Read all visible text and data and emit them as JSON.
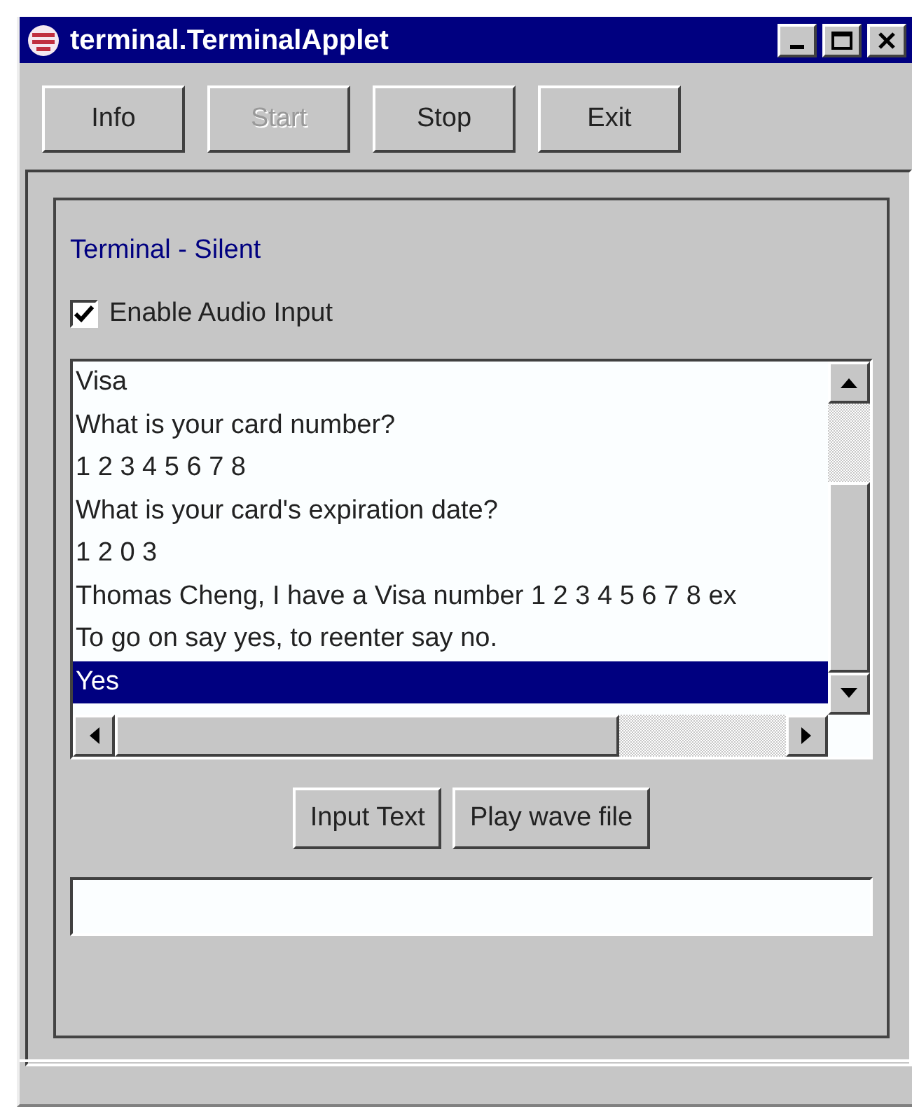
{
  "window": {
    "title": "terminal.TerminalApplet"
  },
  "toolbar": [
    {
      "label": "Info",
      "disabled": false
    },
    {
      "label": "Start",
      "disabled": true
    },
    {
      "label": "Stop",
      "disabled": false
    },
    {
      "label": "Exit",
      "disabled": false
    }
  ],
  "status_label": "Terminal - Silent",
  "audio_checkbox": {
    "label": "Enable Audio Input",
    "checked": true
  },
  "transcript": [
    {
      "text": "Visa",
      "selected": false
    },
    {
      "text": "What is your card number?",
      "selected": false
    },
    {
      "text": "1 2 3 4 5 6 7 8",
      "selected": false
    },
    {
      "text": "What is your card's expiration date?",
      "selected": false
    },
    {
      "text": "1 2 0 3",
      "selected": false
    },
    {
      "text": "Thomas Cheng, I have a Visa number 1 2 3 4 5 6 7 8 ex",
      "selected": false
    },
    {
      "text": "To go on say yes, to reenter say no.",
      "selected": false
    },
    {
      "text": "Yes",
      "selected": true
    }
  ],
  "actions": [
    "Input Text",
    "Play wave file"
  ]
}
